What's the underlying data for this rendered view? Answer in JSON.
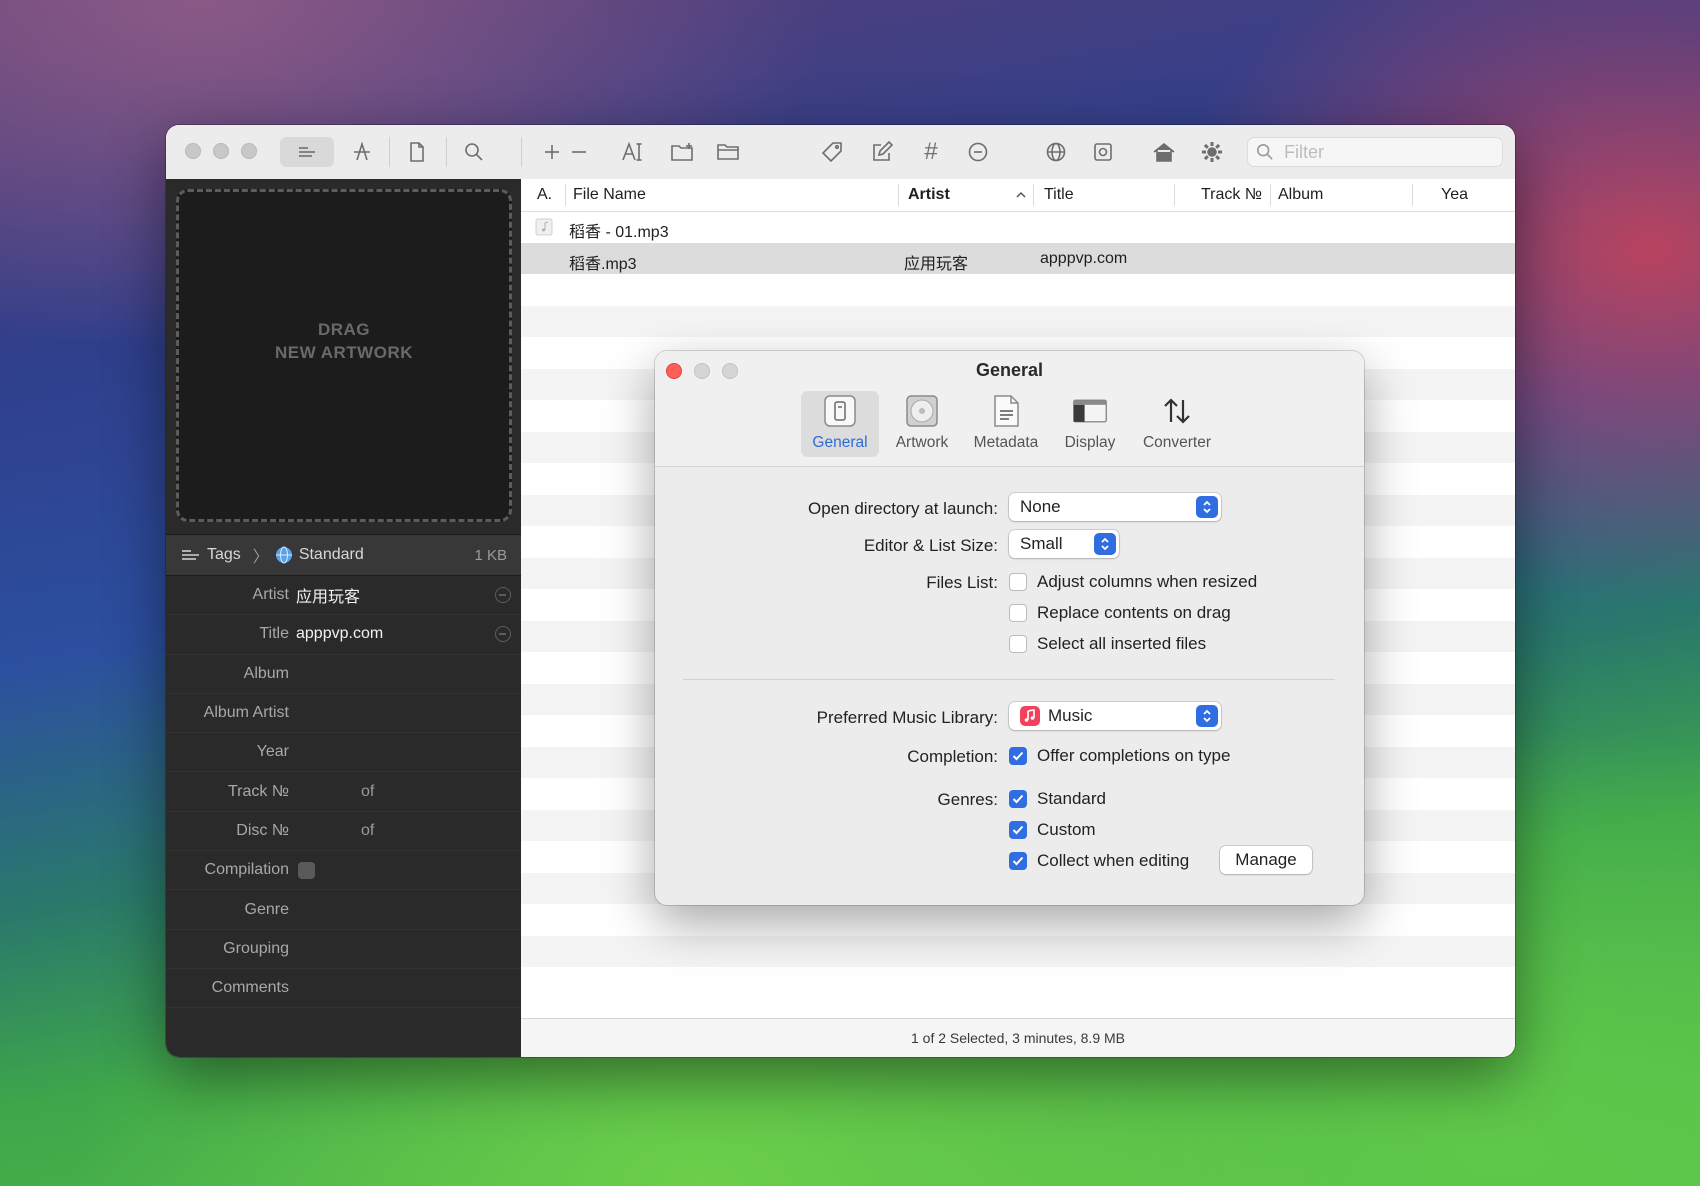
{
  "toolbar": {
    "filter_placeholder": "Filter"
  },
  "left_panel": {
    "artwork_drop": {
      "line1": "DRAG",
      "line2": "NEW ARTWORK"
    },
    "tags_bar": {
      "tags_label": "Tags",
      "chevron": "〉",
      "standard_label": "Standard",
      "size": "1 KB"
    },
    "fields": [
      {
        "label": "Artist",
        "value": "应用玩客",
        "has_clear": true
      },
      {
        "label": "Title",
        "value": "apppvp.com",
        "has_clear": true
      },
      {
        "label": "Album",
        "value": ""
      },
      {
        "label": "Album Artist",
        "value": ""
      },
      {
        "label": "Year",
        "value": ""
      },
      {
        "label": "Track №",
        "of": "of"
      },
      {
        "label": "Disc №",
        "of": "of"
      },
      {
        "label": "Compilation",
        "checkbox": true
      },
      {
        "label": "Genre",
        "value": ""
      },
      {
        "label": "Grouping",
        "value": ""
      },
      {
        "label": "Comments",
        "value": ""
      }
    ]
  },
  "file_list": {
    "columns": [
      "A.",
      "File Name",
      "Artist",
      "Title",
      "Track №",
      "Album",
      "Yea"
    ],
    "rows": [
      {
        "file_name": "稻香 - 01.mp3",
        "artist": "",
        "title": ""
      },
      {
        "file_name": "稻香.mp3",
        "artist": "应用玩客",
        "title": "apppvp.com",
        "selected": true
      }
    ],
    "status": "1 of 2 Selected, 3 minutes, 8.9 MB"
  },
  "dialog": {
    "title": "General",
    "tabs": [
      {
        "label": "General",
        "icon": "general-icon",
        "active": true
      },
      {
        "label": "Artwork",
        "icon": "artwork-icon"
      },
      {
        "label": "Metadata",
        "icon": "metadata-icon"
      },
      {
        "label": "Display",
        "icon": "display-icon"
      },
      {
        "label": "Converter",
        "icon": "converter-icon"
      }
    ],
    "open_directory": {
      "label": "Open directory at launch:",
      "value": "None"
    },
    "editor_size": {
      "label": "Editor & List Size:",
      "value": "Small"
    },
    "files_list": {
      "label": "Files List:",
      "options": [
        {
          "label": "Adjust columns when resized",
          "checked": false
        },
        {
          "label": "Replace contents on drag",
          "checked": false
        },
        {
          "label": "Select all inserted files",
          "checked": false
        }
      ]
    },
    "music_library": {
      "label": "Preferred Music Library:",
      "value": "Music"
    },
    "completion": {
      "label": "Completion:",
      "option": "Offer completions on type",
      "checked": true
    },
    "genres": {
      "label": "Genres:",
      "options": [
        {
          "label": "Standard",
          "checked": true
        },
        {
          "label": "Custom",
          "checked": true
        },
        {
          "label": "Collect when editing",
          "checked": true
        }
      ],
      "manage_label": "Manage"
    }
  },
  "colors": {
    "accent": "#2f6de0",
    "close": "#fe5f57",
    "sidebar_bg": "#2a2a2b"
  }
}
